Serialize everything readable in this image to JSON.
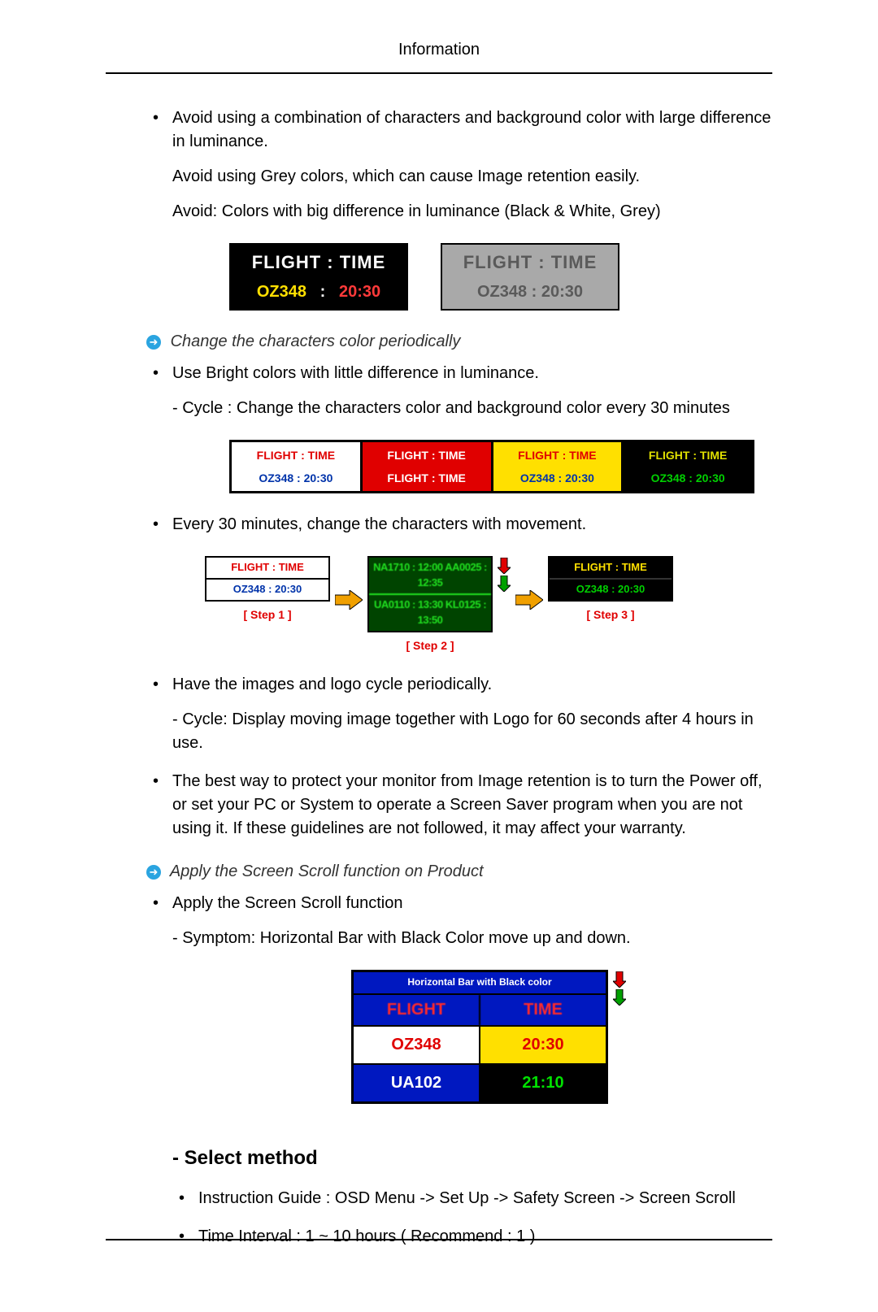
{
  "header": {
    "title": "Information"
  },
  "sec_avoid": {
    "item1": "Avoid using a combination of characters and background color with large difference in luminance.",
    "p_grey": "Avoid using Grey colors, which can cause Image retention easily.",
    "p_colors": "Avoid: Colors with big difference in luminance (Black & White, Grey)"
  },
  "fig1": {
    "panelA": {
      "row1": "FLIGHT  :  TIME",
      "flight": "OZ348",
      "sep": ":",
      "time": "20:30"
    },
    "panelB": {
      "row1": "FLIGHT  :  TIME",
      "row2": "OZ348    :   20:30"
    }
  },
  "callout_change": "Change the characters color periodically",
  "sec_change": {
    "item1": "Use Bright colors with little difference in luminance.",
    "cycle": "- Cycle : Change the characters color and background color every 30 minutes"
  },
  "fig2": {
    "c1": {
      "r1": "FLIGHT  :  TIME",
      "r2": "OZ348    :   20:30"
    },
    "c2": {
      "r1": "FLIGHT  :  TIME",
      "r2": "FLIGHT  :  TIME"
    },
    "c3": {
      "r1": "FLIGHT  :  TIME",
      "r2": "OZ348    :   20:30"
    },
    "c4": {
      "r1": "FLIGHT  :  TIME",
      "r2": "OZ348    :   20:30"
    }
  },
  "sec_move": {
    "item": "Every 30 minutes, change the characters with movement."
  },
  "fig3": {
    "s1": {
      "top": "FLIGHT  :  TIME",
      "bot": "OZ348   :  20:30",
      "label": "[  Step 1  ]"
    },
    "s2": {
      "top": "NA1710 : 12:00  AA0025 : 12:35",
      "bot": "UA0110 : 13:30  KL0125 : 13:50",
      "label": "[  Step 2  ]"
    },
    "s3": {
      "top": "FLIGHT  :  TIME",
      "bot": "OZ348   :  20:30",
      "label": "[  Step 3  ]"
    }
  },
  "sec_logo": {
    "item": "Have the images and logo cycle periodically.",
    "cycle": "- Cycle: Display moving image together with Logo for 60 seconds after 4 hours in use."
  },
  "sec_best": {
    "item": "The best way to protect your monitor from Image retention is to turn the Power off, or set your PC or System to operate a Screen Saver program when you are not using it. If these guidelines are not followed, it may affect your warranty."
  },
  "callout_scroll": "Apply the Screen Scroll function on Product",
  "sec_scroll": {
    "item": "Apply the Screen Scroll function",
    "symptom": "- Symptom: Horizontal Bar with Black Color move up and down."
  },
  "fig4": {
    "hdr": "Horizontal Bar with Black color",
    "hcol1": "FLIGHT",
    "hcol2": "TIME",
    "rows": [
      {
        "f": "OZ348",
        "t": "20:30"
      },
      {
        "f": "UA102",
        "t": "21:10"
      }
    ]
  },
  "h_select": "Select method",
  "sec_select": {
    "item1": "Instruction Guide : OSD Menu -> Set Up -> Safety Screen -> Screen Scroll",
    "item2": "Time Interval : 1 ~ 10 hours ( Recommend : 1 )"
  }
}
